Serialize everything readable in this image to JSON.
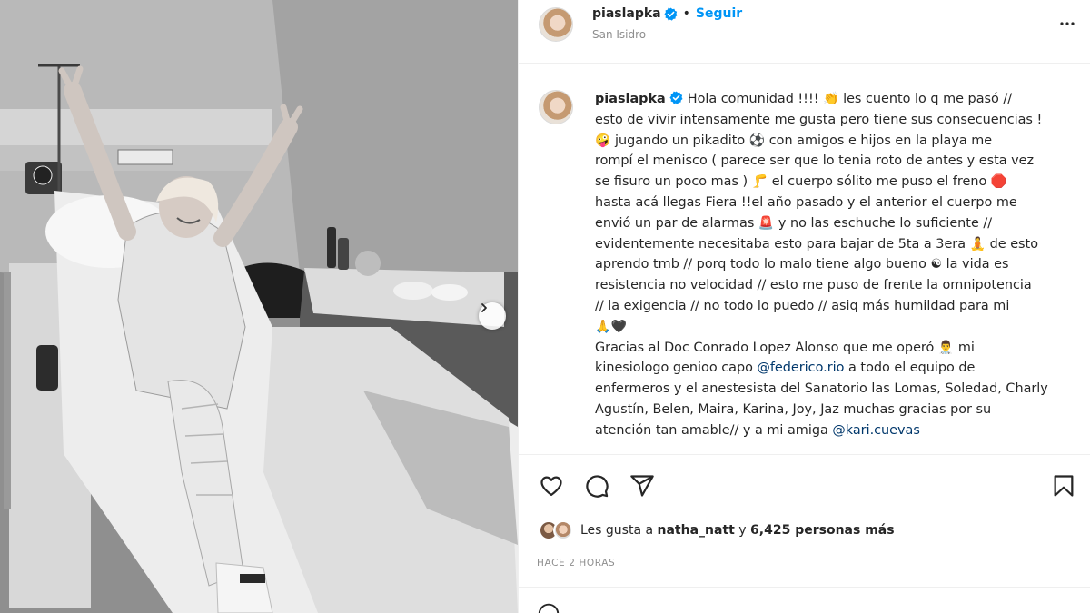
{
  "post": {
    "username": "piaslapka",
    "follow_label": "Seguir",
    "separator": "•",
    "location": "San Isidro"
  },
  "caption": {
    "username": "piaslapka",
    "lines": [
      {
        "parts": [
          {
            "t": "Hola comunidad !!!! "
          },
          {
            "e": "👏"
          },
          {
            "t": " les cuento lo q me pasó //"
          }
        ]
      },
      {
        "parts": [
          {
            "t": "esto de vivir intensamente me gusta pero tiene sus consecuencias !"
          }
        ]
      },
      {
        "parts": [
          {
            "e": "🤪"
          },
          {
            "t": " jugando un pikadito "
          },
          {
            "e": "⚽"
          },
          {
            "t": " con amigos e hijos en la playa me"
          }
        ]
      },
      {
        "parts": [
          {
            "t": "rompí el menisco ( parece ser que lo tenia roto de antes y esta vez"
          }
        ]
      },
      {
        "parts": [
          {
            "t": "se fisuro un poco mas ) "
          },
          {
            "e": "🦵"
          },
          {
            "t": " el cuerpo sólito me puso el freno "
          },
          {
            "e": "🛑"
          }
        ]
      },
      {
        "parts": [
          {
            "t": "hasta acá llegas Fiera !!el año pasado y el anterior el cuerpo me"
          }
        ]
      },
      {
        "parts": [
          {
            "t": "envió un par de alarmas "
          },
          {
            "e": "🚨"
          },
          {
            "t": " y no las eschuche lo suficiente //"
          }
        ]
      },
      {
        "parts": [
          {
            "t": "evidentemente necesitaba esto para bajar de 5ta a 3era "
          },
          {
            "e": "🧘"
          },
          {
            "t": " de esto"
          }
        ]
      },
      {
        "parts": [
          {
            "t": "aprendo tmb // porq todo lo malo tiene algo bueno "
          },
          {
            "e": "☯"
          },
          {
            "t": " la vida es"
          }
        ]
      },
      {
        "parts": [
          {
            "t": "resistencia no velocidad // esto me puso de frente la omnipotencia"
          }
        ]
      },
      {
        "parts": [
          {
            "t": "// la exigencia // no todo lo puedo // asiq más humildad para mi"
          }
        ]
      },
      {
        "parts": [
          {
            "e": "🙏"
          },
          {
            "e": "🖤"
          }
        ]
      },
      {
        "parts": [
          {
            "t": "Gracias al Doc Conrado Lopez Alonso que me operó "
          },
          {
            "e": "👨‍⚕️"
          },
          {
            "t": " mi"
          }
        ]
      },
      {
        "parts": [
          {
            "t": "kinesiologo genioo capo "
          },
          {
            "m": "@federico.rio"
          },
          {
            "t": " a todo el equipo de"
          }
        ]
      },
      {
        "parts": [
          {
            "t": "enfermeros y el anestesista del Sanatorio las Lomas, Soledad, Charly"
          }
        ]
      },
      {
        "parts": [
          {
            "t": "Agustín, Belen, Maira, Karina, Joy, Jaz muchas gracias por su"
          }
        ]
      },
      {
        "parts": [
          {
            "t": "atención tan amable// y a mi amiga "
          },
          {
            "m": "@kari.cuevas"
          }
        ]
      },
      {
        "parts": [
          {
            "t": "                  "
          }
        ]
      }
    ]
  },
  "actions": {
    "likes_prefix": "Les gusta a",
    "likes_user": "natha_natt",
    "likes_connector": "y",
    "likes_count": "6,425 personas más",
    "time_ago": "HACE 2 HORAS"
  },
  "icons": {
    "verified": "verified-badge-icon",
    "more": "more-options-icon",
    "like": "heart-icon",
    "comment": "comment-icon",
    "share": "share-icon",
    "save": "bookmark-icon",
    "next": "chevron-right-icon"
  },
  "colors": {
    "accent": "#0095f6",
    "mention": "#00376b",
    "text": "#262626",
    "secondary": "#8e8e8e",
    "border": "#efefef"
  }
}
